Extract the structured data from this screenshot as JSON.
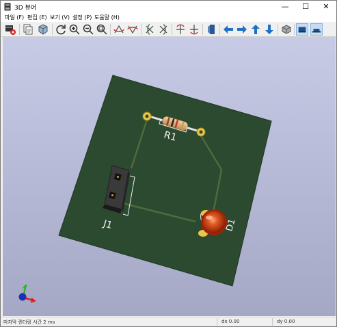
{
  "window": {
    "title": "3D 뷰어",
    "minimize_glyph": "—",
    "maximize_glyph": "☐",
    "close_glyph": "✕"
  },
  "menu": {
    "items": [
      {
        "label": "파일 (F)"
      },
      {
        "label": "편집 (E)"
      },
      {
        "label": "보기 (V)"
      },
      {
        "label": "설정 (P)"
      },
      {
        "label": "도움말 (H)"
      }
    ]
  },
  "toolbar": {
    "buttons": [
      {
        "icon": "render-image-icon"
      },
      {
        "icon": "copy-icon"
      },
      {
        "icon": "cube-3d-icon"
      },
      {
        "icon": "refresh-icon"
      },
      {
        "icon": "zoom-in-icon"
      },
      {
        "icon": "zoom-out-icon"
      },
      {
        "icon": "zoom-fit-icon"
      },
      {
        "icon": "rotate-x-cw-icon"
      },
      {
        "icon": "rotate-x-ccw-icon"
      },
      {
        "icon": "rotate-y-cw-icon"
      },
      {
        "icon": "rotate-y-ccw-icon"
      },
      {
        "icon": "rotate-z-cw-icon"
      },
      {
        "icon": "rotate-z-ccw-icon"
      },
      {
        "icon": "flip-board-icon"
      },
      {
        "icon": "arrow-left-icon"
      },
      {
        "icon": "arrow-right-icon"
      },
      {
        "icon": "arrow-up-icon"
      },
      {
        "icon": "arrow-down-icon"
      },
      {
        "icon": "orthographic-icon"
      },
      {
        "icon": "bounding-box-icon",
        "active": true
      },
      {
        "icon": "show-board-body-icon",
        "active": true
      }
    ]
  },
  "board": {
    "components": [
      {
        "ref": "R1"
      },
      {
        "ref": "J1"
      },
      {
        "ref": "D1"
      }
    ],
    "colors": {
      "background_top": "#c7cbe6",
      "background_bottom": "#a4a8c5",
      "board": "#2b4a2f",
      "track": "#4f6b3c",
      "silkscreen": "#f2f2f2",
      "led": "#d43a12",
      "pad": "#e8c64b"
    }
  },
  "status": {
    "render_time": "마지막 렌더링 시간 2 ms",
    "dx": "dx 0.00",
    "dy": "dy 0.00"
  }
}
